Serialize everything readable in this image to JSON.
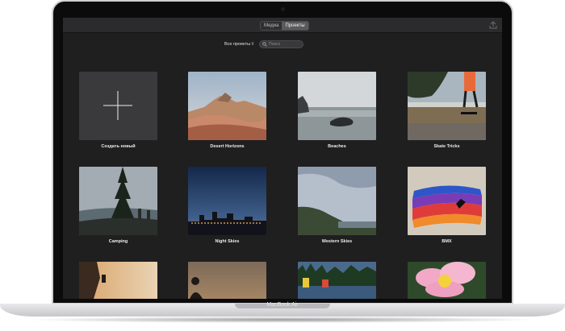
{
  "device": {
    "brand_label": "MacBook Air"
  },
  "toolbar": {
    "tabs": [
      {
        "label": "Медиа",
        "active": false
      },
      {
        "label": "Проекты",
        "active": true
      }
    ],
    "import_icon": "import-icon"
  },
  "filter": {
    "label": "Все проекты ◊"
  },
  "search": {
    "placeholder": "Поиск",
    "icon": "magnifier-icon"
  },
  "projects": [
    {
      "title": "Создать новый",
      "type": "new"
    },
    {
      "title": "Desert Horizons"
    },
    {
      "title": "Beaches"
    },
    {
      "title": "Skate Tricks"
    },
    {
      "title": "Camping"
    },
    {
      "title": "Night Skies"
    },
    {
      "title": "Western Skies"
    },
    {
      "title": "BMX"
    },
    {
      "title": ""
    },
    {
      "title": ""
    },
    {
      "title": ""
    },
    {
      "title": ""
    }
  ],
  "colors": {
    "background": "#1f1f20",
    "toolbar": "#2b2b2d",
    "tile_new": "#3a3a3c"
  }
}
